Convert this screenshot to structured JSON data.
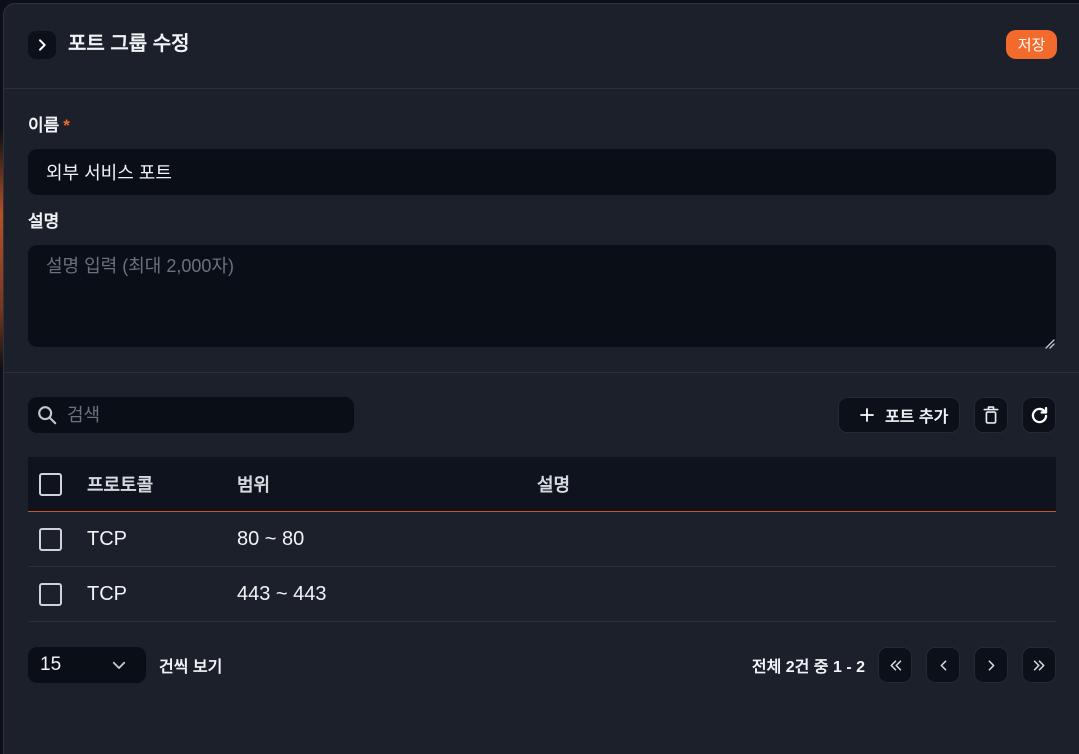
{
  "header": {
    "collapse_icon": "chevron-right-icon",
    "title": "포트 그룹 수정",
    "save_label": "저장"
  },
  "form": {
    "name": {
      "label": "이름",
      "required_mark": "*",
      "value": "외부 서비스 포트"
    },
    "description": {
      "label": "설명",
      "placeholder": "설명 입력 (최대 2,000자)",
      "resize_icon": "resize-handle-icon"
    }
  },
  "toolbar": {
    "search_icon": "search-icon",
    "search_placeholder": "검색",
    "add_port_icon": "plus-icon",
    "add_port_label": "포트 추가",
    "delete_icon": "trash-icon",
    "refresh_icon": "refresh-icon"
  },
  "table": {
    "select_all_checked": false,
    "columns": [
      "프로토콜",
      "범위",
      "설명"
    ],
    "rows": [
      {
        "checked": false,
        "protocol": "TCP",
        "range": "80 ~ 80"
      },
      {
        "checked": false,
        "protocol": "TCP",
        "range": "443 ~ 443"
      }
    ]
  },
  "pagination": {
    "page_size": "15",
    "page_size_icon": "chevron-down-icon",
    "page_size_suffix": "건씩 보기",
    "summary": "전체 2건 중 1 - 2",
    "nav_icons": [
      "chevrons-left-icon",
      "chevron-left-icon",
      "chevron-right-icon",
      "chevrons-right-icon"
    ]
  },
  "colors": {
    "accent": "#f26b2c",
    "panel_bg": "#1b202b",
    "input_bg": "#0a0e16",
    "control_bg": "#0c1018",
    "control_border": "#242a35",
    "text_primary": "#f1f3f6",
    "text_secondary": "#d6d9de",
    "text_muted": "#6b717d",
    "divider": "#2a2f3a",
    "table_header_bg": "#0f131d",
    "table_header_border": "#c45a2a"
  }
}
